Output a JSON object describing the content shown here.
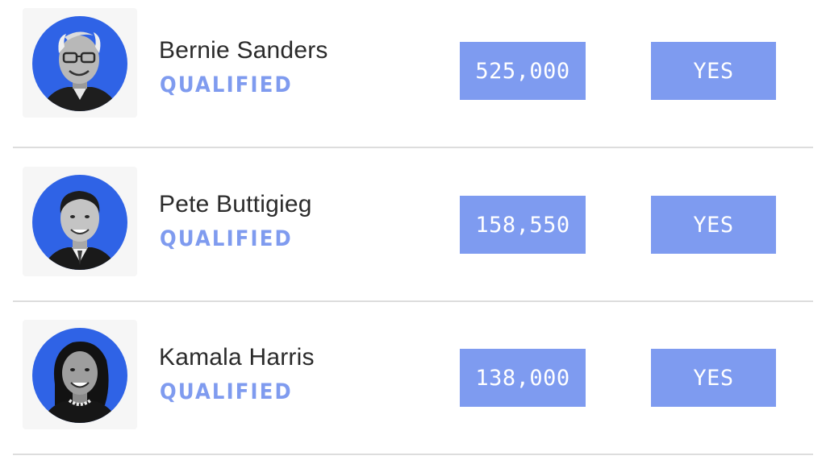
{
  "candidates": [
    {
      "name": "Bernie Sanders",
      "status": "QUALIFIED",
      "donors": "525,000",
      "polling": "YES",
      "photo": "avatar-bernie-sanders"
    },
    {
      "name": "Pete Buttigieg",
      "status": "QUALIFIED",
      "donors": "158,550",
      "polling": "YES",
      "photo": "avatar-pete-buttigieg"
    },
    {
      "name": "Kamala Harris",
      "status": "QUALIFIED",
      "donors": "138,000",
      "polling": "YES",
      "photo": "avatar-kamala-harris"
    }
  ],
  "colors": {
    "avatar_ring": "#2f63e6",
    "status_text": "#7f9bef",
    "pill_bg": "#7e9bf0",
    "pill_text": "#ffffff",
    "name_text": "#2b2b2b",
    "divider": "#dddddd"
  }
}
